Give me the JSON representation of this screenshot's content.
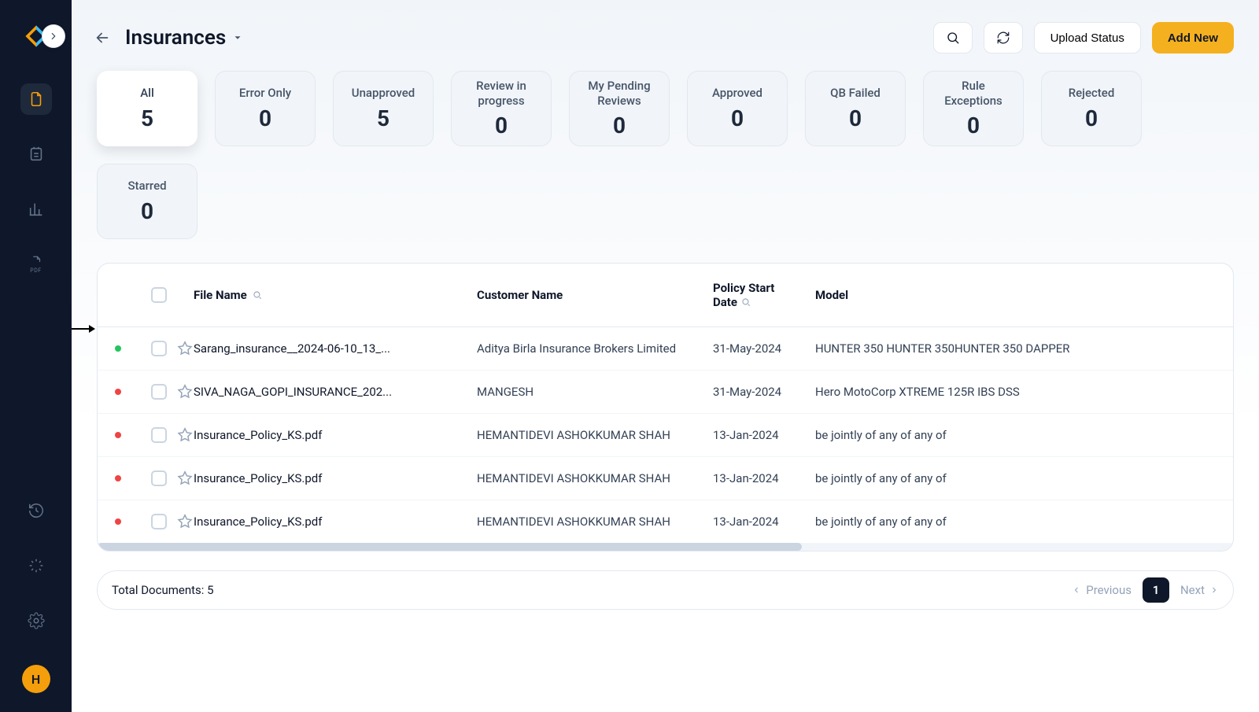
{
  "header": {
    "title": "Insurances",
    "upload_status": "Upload Status",
    "add_new": "Add New"
  },
  "avatar_initial": "H",
  "filters": [
    {
      "label": "All",
      "count": "5",
      "active": true
    },
    {
      "label": "Error Only",
      "count": "0",
      "active": false
    },
    {
      "label": "Unapproved",
      "count": "5",
      "active": false
    },
    {
      "label": "Review in progress",
      "count": "0",
      "active": false
    },
    {
      "label": "My Pending Reviews",
      "count": "0",
      "active": false
    },
    {
      "label": "Approved",
      "count": "0",
      "active": false
    },
    {
      "label": "QB Failed",
      "count": "0",
      "active": false
    },
    {
      "label": "Rule Exceptions",
      "count": "0",
      "active": false
    },
    {
      "label": "Rejected",
      "count": "0",
      "active": false
    },
    {
      "label": "Starred",
      "count": "0",
      "active": false
    }
  ],
  "columns": {
    "file_name": "File Name",
    "customer_name": "Customer Name",
    "policy_start_date_l1": "Policy Start",
    "policy_start_date_l2": "Date",
    "model": "Model"
  },
  "rows": [
    {
      "status": "green",
      "file": "Sarang_insurance__2024-06-10_13_...",
      "customer": "Aditya Birla Insurance Brokers Limited",
      "date": "31-May-2024",
      "model": "HUNTER 350 HUNTER 350HUNTER 350 DAPPER"
    },
    {
      "status": "red",
      "file": "SIVA_NAGA_GOPI_INSURANCE_202...",
      "customer": "MANGESH",
      "date": "31-May-2024",
      "model": "Hero MotoCorp XTREME 125R IBS DSS"
    },
    {
      "status": "red",
      "file": "Insurance_Policy_KS.pdf",
      "customer": "HEMANTIDEVI ASHOKKUMAR SHAH",
      "date": "13-Jan-2024",
      "model": "be jointly of any of any of"
    },
    {
      "status": "red",
      "file": "Insurance_Policy_KS.pdf",
      "customer": "HEMANTIDEVI ASHOKKUMAR SHAH",
      "date": "13-Jan-2024",
      "model": "be jointly of any of any of"
    },
    {
      "status": "red",
      "file": "Insurance_Policy_KS.pdf",
      "customer": "HEMANTIDEVI ASHOKKUMAR SHAH",
      "date": "13-Jan-2024",
      "model": "be jointly of any of any of"
    }
  ],
  "footer": {
    "total_label": "Total Documents:",
    "total_value": "5",
    "previous": "Previous",
    "next": "Next",
    "page": "1"
  }
}
